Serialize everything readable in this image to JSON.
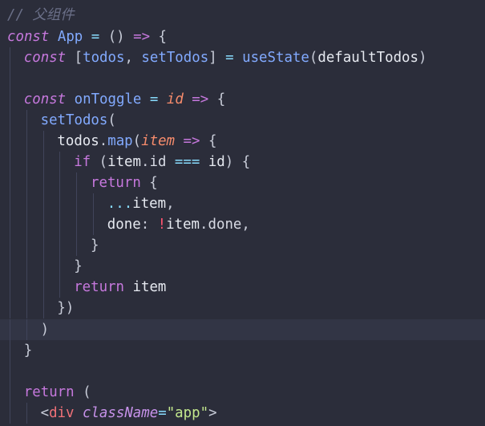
{
  "lines": [
    {
      "tokens": [
        {
          "t": "// 父组件",
          "c": "c-comment"
        }
      ]
    },
    {
      "tokens": [
        {
          "t": "const",
          "c": "c-kw"
        },
        {
          "t": " ",
          "c": "c-plain"
        },
        {
          "t": "App",
          "c": "c-fn"
        },
        {
          "t": " ",
          "c": "c-plain"
        },
        {
          "t": "=",
          "c": "c-op"
        },
        {
          "t": " () ",
          "c": "c-punct"
        },
        {
          "t": "=>",
          "c": "c-kw2"
        },
        {
          "t": " {",
          "c": "c-punct"
        }
      ]
    },
    {
      "tokens": [
        {
          "t": "const",
          "c": "c-kw"
        },
        {
          "t": " [",
          "c": "c-punct"
        },
        {
          "t": "todos",
          "c": "c-var"
        },
        {
          "t": ", ",
          "c": "c-punct"
        },
        {
          "t": "setTodos",
          "c": "c-var"
        },
        {
          "t": "] ",
          "c": "c-punct"
        },
        {
          "t": "=",
          "c": "c-op"
        },
        {
          "t": " ",
          "c": "c-plain"
        },
        {
          "t": "useState",
          "c": "c-fn"
        },
        {
          "t": "(",
          "c": "c-punct"
        },
        {
          "t": "defaultTodos",
          "c": "c-plain"
        },
        {
          "t": ")",
          "c": "c-punct"
        }
      ]
    },
    {
      "tokens": []
    },
    {
      "tokens": [
        {
          "t": "const",
          "c": "c-kw"
        },
        {
          "t": " ",
          "c": "c-plain"
        },
        {
          "t": "onToggle",
          "c": "c-fn"
        },
        {
          "t": " ",
          "c": "c-plain"
        },
        {
          "t": "=",
          "c": "c-op"
        },
        {
          "t": " ",
          "c": "c-plain"
        },
        {
          "t": "id",
          "c": "c-param"
        },
        {
          "t": " ",
          "c": "c-plain"
        },
        {
          "t": "=>",
          "c": "c-kw2"
        },
        {
          "t": " {",
          "c": "c-punct"
        }
      ]
    },
    {
      "tokens": [
        {
          "t": "setTodos",
          "c": "c-fn"
        },
        {
          "t": "(",
          "c": "c-punct"
        }
      ]
    },
    {
      "tokens": [
        {
          "t": "todos",
          "c": "c-plain"
        },
        {
          "t": ".",
          "c": "c-punct"
        },
        {
          "t": "map",
          "c": "c-fn"
        },
        {
          "t": "(",
          "c": "c-punct"
        },
        {
          "t": "item",
          "c": "c-param"
        },
        {
          "t": " ",
          "c": "c-plain"
        },
        {
          "t": "=>",
          "c": "c-kw2"
        },
        {
          "t": " {",
          "c": "c-punct"
        }
      ]
    },
    {
      "tokens": [
        {
          "t": "if",
          "c": "c-kw2"
        },
        {
          "t": " (",
          "c": "c-punct"
        },
        {
          "t": "item",
          "c": "c-plain"
        },
        {
          "t": ".",
          "c": "c-punct"
        },
        {
          "t": "id",
          "c": "c-prop"
        },
        {
          "t": " ",
          "c": "c-plain"
        },
        {
          "t": "===",
          "c": "c-op"
        },
        {
          "t": " ",
          "c": "c-plain"
        },
        {
          "t": "id",
          "c": "c-plain"
        },
        {
          "t": ") {",
          "c": "c-punct"
        }
      ]
    },
    {
      "tokens": [
        {
          "t": "return",
          "c": "c-kw2"
        },
        {
          "t": " {",
          "c": "c-punct"
        }
      ]
    },
    {
      "tokens": [
        {
          "t": "...",
          "c": "c-op"
        },
        {
          "t": "item",
          "c": "c-plain"
        },
        {
          "t": ",",
          "c": "c-punct"
        }
      ]
    },
    {
      "tokens": [
        {
          "t": "done",
          "c": "c-plain"
        },
        {
          "t": ": ",
          "c": "c-punct"
        },
        {
          "t": "!",
          "c": "c-excl"
        },
        {
          "t": "item",
          "c": "c-plain"
        },
        {
          "t": ".",
          "c": "c-punct"
        },
        {
          "t": "done",
          "c": "c-prop"
        },
        {
          "t": ",",
          "c": "c-punct"
        }
      ]
    },
    {
      "tokens": [
        {
          "t": "}",
          "c": "c-punct"
        }
      ]
    },
    {
      "tokens": [
        {
          "t": "}",
          "c": "c-punct"
        }
      ]
    },
    {
      "tokens": [
        {
          "t": "return",
          "c": "c-kw2"
        },
        {
          "t": " ",
          "c": "c-plain"
        },
        {
          "t": "item",
          "c": "c-plain"
        }
      ]
    },
    {
      "tokens": [
        {
          "t": "})",
          "c": "c-punct"
        }
      ]
    },
    {
      "tokens": [
        {
          "t": ")",
          "c": "c-punct"
        }
      ]
    },
    {
      "tokens": [
        {
          "t": "}",
          "c": "c-punct"
        }
      ]
    },
    {
      "tokens": []
    },
    {
      "tokens": [
        {
          "t": "return",
          "c": "c-kw2"
        },
        {
          "t": " (",
          "c": "c-punct"
        }
      ]
    },
    {
      "tokens": [
        {
          "t": "<",
          "c": "c-punct"
        },
        {
          "t": "div",
          "c": "c-tag"
        },
        {
          "t": " ",
          "c": "c-plain"
        },
        {
          "t": "className",
          "c": "c-attr"
        },
        {
          "t": "=",
          "c": "c-op"
        },
        {
          "t": "\"app\"",
          "c": "c-str"
        },
        {
          "t": ">",
          "c": "c-punct"
        }
      ]
    }
  ]
}
